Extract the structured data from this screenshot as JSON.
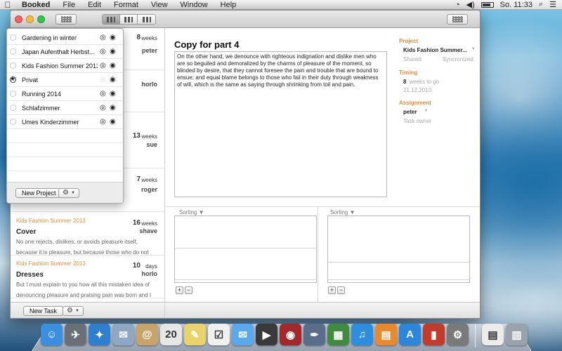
{
  "menubar": {
    "apple_icon": "apple-logo",
    "app_name": "Booked",
    "menus": [
      "File",
      "Edit",
      "Format",
      "View",
      "Window",
      "Help"
    ],
    "clock": "So. 11:33"
  },
  "tasks": [
    {
      "project": "",
      "name": "",
      "desc1": "",
      "desc2": "",
      "num": "8",
      "unit": "weeks",
      "owner": "peter"
    },
    {
      "project": "",
      "name": "",
      "desc1": "",
      "desc2": "",
      "num": "",
      "unit": "",
      "owner": "horlo"
    },
    {
      "project": "",
      "name": "",
      "desc1": "",
      "desc2": "",
      "num": "13",
      "unit": "weeks",
      "owner": "sue"
    },
    {
      "project": "",
      "name": "",
      "desc1": "",
      "desc2": "",
      "num": "7",
      "unit": "weeks",
      "owner": "roger"
    },
    {
      "project": "Kids Fashion Summer 2013",
      "name": "Cover",
      "desc1": "No one rejects, dislikes, or avoids pleasure itself,",
      "desc2": "because it is pleasure, but because those who do not",
      "num": "16",
      "unit": "weeks",
      "owner": "shave"
    },
    {
      "project": "Kids Fashion Summer 2013",
      "name": "Dresses",
      "desc1": "But I must explain to you how all this mistaken idea of",
      "desc2": "denouncing pleasure and praising pain was born and I",
      "num": "10",
      "unit": "days",
      "owner": "horlo"
    }
  ],
  "task_footer": {
    "new_task": "New Task"
  },
  "detail": {
    "title": "Copy for part 4",
    "body": "On the other hand, we denounce with righteous indignation and dislike men who are so beguiled and demoralized by the charms of pleasure of the moment, so blinded by desire, that they cannot foresee the pain and trouble that are bound to ensue; and equal blame belongs to those who fail in their duty through weakness of will, which is the same as saying through shrinking from toil and pain.",
    "project_header": "Project",
    "project_value": "Kids Fashion Summer...",
    "shared_label": "Shared",
    "synced_label": "Syncronized",
    "timing_header": "Timing",
    "timing_num": "8",
    "timing_text": "weeks to go",
    "timing_date": "21.12.2013",
    "assignment_header": "Assignment",
    "assignee": "peter",
    "owner_label": "Task owner",
    "sorting_label": "Sorting",
    "add": "+",
    "remove": "−"
  },
  "projects_popover": {
    "items": [
      {
        "name": "Gardening in winter",
        "selected": false,
        "shared": true
      },
      {
        "name": "Japan Aufenthalt Herbst...",
        "selected": false,
        "shared": true
      },
      {
        "name": "Kids Fashion Summer 2013",
        "selected": false,
        "shared": true
      },
      {
        "name": "Privat",
        "selected": true,
        "shared": false
      },
      {
        "name": "Running 2014",
        "selected": false,
        "shared": true
      },
      {
        "name": "Schlafzimmer",
        "selected": false,
        "shared": true
      },
      {
        "name": "Umes Kinderzimmer",
        "selected": false,
        "shared": true
      }
    ],
    "new_project": "New Project"
  },
  "dock": {
    "items": [
      {
        "name": "finder",
        "glyph": "☺",
        "color": "#3b8fe0"
      },
      {
        "name": "launchpad",
        "glyph": "✈",
        "color": "#6a6f78"
      },
      {
        "name": "safari",
        "glyph": "✦",
        "color": "#2f7fd0"
      },
      {
        "name": "mail",
        "glyph": "✉",
        "color": "#8fa7c2"
      },
      {
        "name": "contacts",
        "glyph": "@",
        "color": "#c9a46a"
      },
      {
        "name": "calendar",
        "glyph": "20",
        "color": "#e6e6e6"
      },
      {
        "name": "notes",
        "glyph": "✎",
        "color": "#e9d36a"
      },
      {
        "name": "reminders",
        "glyph": "☑",
        "color": "#f0f0f0"
      },
      {
        "name": "messages",
        "glyph": "✉",
        "color": "#5aa9ec"
      },
      {
        "name": "facetime",
        "glyph": "▶",
        "color": "#3a3a3a"
      },
      {
        "name": "photo-booth",
        "glyph": "◉",
        "color": "#a2282a"
      },
      {
        "name": "preview",
        "glyph": "✒",
        "color": "#5a6e8c"
      },
      {
        "name": "numbers",
        "glyph": "▦",
        "color": "#3f8c3f"
      },
      {
        "name": "itunes",
        "glyph": "♫",
        "color": "#2d8ee0"
      },
      {
        "name": "ibooks",
        "glyph": "▤",
        "color": "#e8892b"
      },
      {
        "name": "app-store",
        "glyph": "A",
        "color": "#2c86db"
      },
      {
        "name": "booked-app",
        "glyph": "▮",
        "color": "#c23b2b"
      },
      {
        "name": "system-preferences",
        "glyph": "⚙",
        "color": "#7a7a7a"
      }
    ],
    "right_items": [
      {
        "name": "document-stack",
        "glyph": "▤",
        "color": "#ececec"
      },
      {
        "name": "trash",
        "glyph": "▥",
        "color": "#9aa3ad"
      }
    ]
  }
}
